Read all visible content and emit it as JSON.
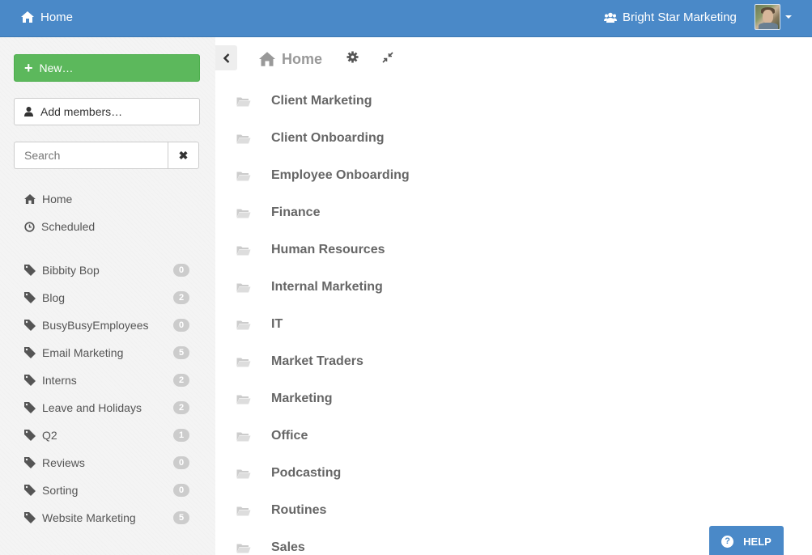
{
  "topbar": {
    "home_label": "Home",
    "org_name": "Bright Star Marketing",
    "bg_color": "#4a89c8"
  },
  "sidebar": {
    "new_button": "New…",
    "add_members_button": "Add members…",
    "search": {
      "placeholder": "Search",
      "value": ""
    },
    "nav": [
      {
        "label": "Home",
        "icon": "home-icon"
      },
      {
        "label": "Scheduled",
        "icon": "clock-icon"
      }
    ],
    "tags": [
      {
        "label": "Bibbity Bop",
        "count": "0"
      },
      {
        "label": "Blog",
        "count": "2"
      },
      {
        "label": "BusyBusyEmployees",
        "count": "0"
      },
      {
        "label": "Email Marketing",
        "count": "5"
      },
      {
        "label": "Interns",
        "count": "2"
      },
      {
        "label": "Leave and Holidays",
        "count": "2"
      },
      {
        "label": "Q2",
        "count": "1"
      },
      {
        "label": "Reviews",
        "count": "0"
      },
      {
        "label": "Sorting",
        "count": "0"
      },
      {
        "label": "Website Marketing",
        "count": "5"
      }
    ],
    "new_button_color": "#5cb85c"
  },
  "main": {
    "title": "Home",
    "folders": [
      "Client Marketing",
      "Client Onboarding",
      "Employee Onboarding",
      "Finance",
      "Human Resources",
      "Internal Marketing",
      "IT",
      "Market Traders",
      "Marketing",
      "Office",
      "Podcasting",
      "Routines",
      "Sales"
    ]
  },
  "help": {
    "label": "HELP"
  }
}
